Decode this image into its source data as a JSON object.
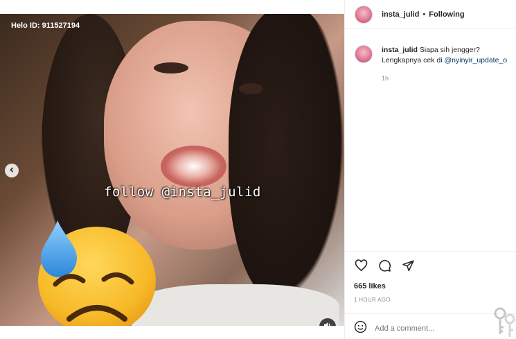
{
  "post": {
    "watermark": "Helo ID: 911527194",
    "overlay_text": "follow @insta_julid"
  },
  "header": {
    "username": "insta_julid",
    "separator": "•",
    "follow_status": "Following"
  },
  "caption": {
    "username": "insta_julid",
    "text": "Siapa sih jengger?",
    "line2_prefix": "Lengkapnya cek di ",
    "mention": "@nyinyir_update_o",
    "time": "1h"
  },
  "stats": {
    "likes": "665 likes",
    "time_ago": "1 HOUR AGO"
  },
  "comment": {
    "placeholder": "Add a comment..."
  },
  "icons": {
    "like": "heart-icon",
    "comment": "comment-bubble-icon",
    "share": "paper-plane-icon",
    "emoji": "smiley-icon",
    "prev": "chevron-left-icon",
    "sound": "speaker-icon"
  },
  "colors": {
    "link": "#00376b",
    "muted": "#8e8e8e",
    "text": "#262626"
  }
}
